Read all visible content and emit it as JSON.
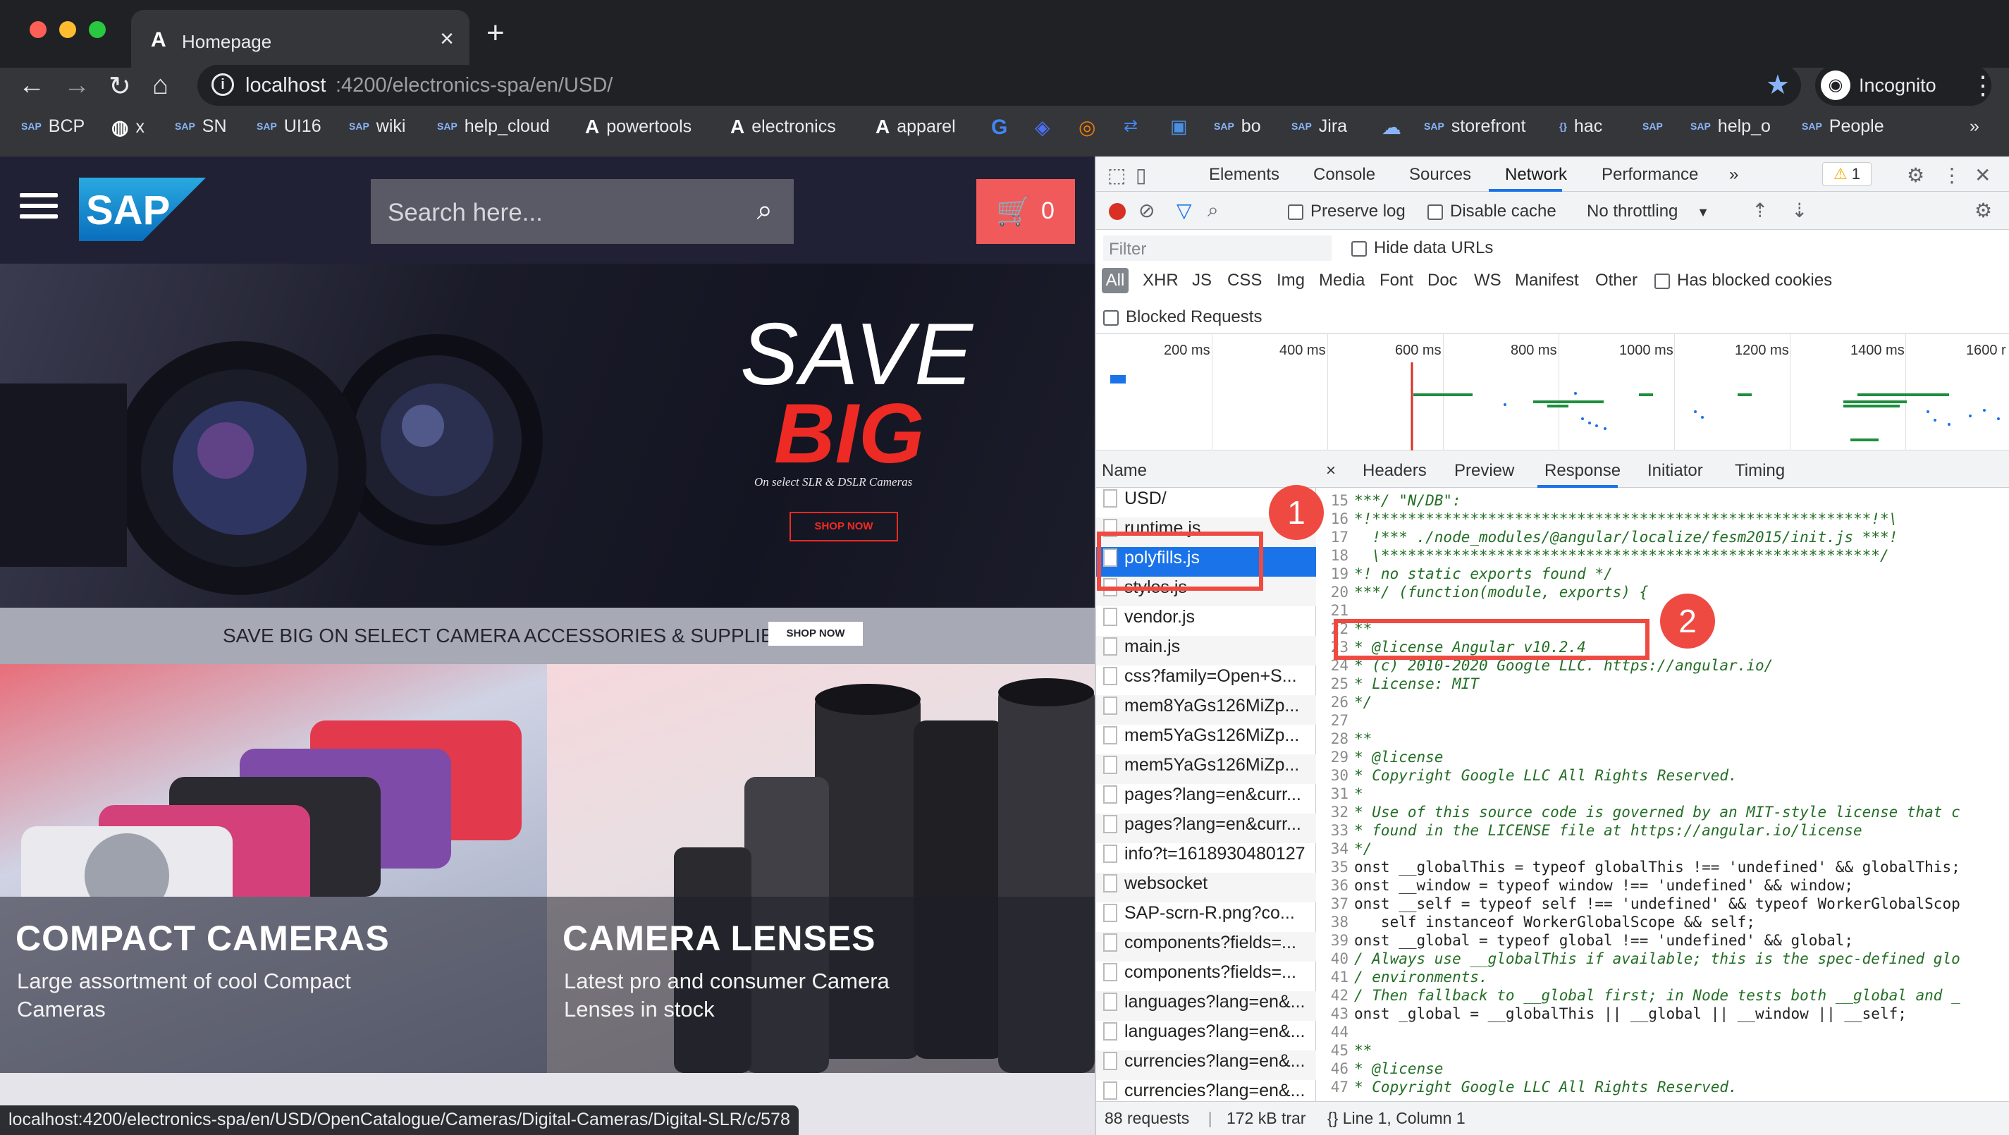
{
  "browser": {
    "tab_title": "Homepage",
    "tab_icon": "angular-icon",
    "address_host": "localhost",
    "address_path": ":4200/electronics-spa/en/USD/",
    "profile_label": "Incognito",
    "status_url": "localhost:4200/electronics-spa/en/USD/OpenCatalogue/Cameras/Digital-Cameras/Digital-SLR/c/578"
  },
  "bookmarks": [
    {
      "label": "BCP",
      "icon": "sap-icon"
    },
    {
      "label": "x",
      "icon": "globe-icon"
    },
    {
      "label": "SN",
      "icon": "sap-icon"
    },
    {
      "label": "UI16",
      "icon": "sap-icon"
    },
    {
      "label": "wiki",
      "icon": "sap-icon"
    },
    {
      "label": "help_cloud",
      "icon": "sap-icon"
    },
    {
      "label": "powertools",
      "icon": "angular-icon"
    },
    {
      "label": "electronics",
      "icon": "angular-icon"
    },
    {
      "label": "apparel",
      "icon": "angular-icon"
    },
    {
      "label": "bo",
      "icon": "sap-icon"
    },
    {
      "label": "Jira",
      "icon": "sap-icon"
    },
    {
      "label": "storefront",
      "icon": "sap-icon"
    },
    {
      "label": "hac",
      "icon": "sap-icon"
    },
    {
      "label": "help_o",
      "icon": "sap-icon"
    },
    {
      "label": "People",
      "icon": "sap-icon"
    },
    {
      "label": "»",
      "icon": "more-icon"
    }
  ],
  "site": {
    "search_placeholder": "Search here...",
    "cart_count": "0",
    "hero_line1": "SAVE",
    "hero_line2": "BIG",
    "hero_sub": "On select SLR & DSLR Cameras",
    "hero_button": "SHOP NOW",
    "promo_text": "SAVE BIG ON SELECT CAMERA ACCESSORIES & SUPPLIES",
    "promo_button": "SHOP NOW",
    "tiles": [
      {
        "title": "COMPACT CAMERAS",
        "desc": "Large assortment of cool Compact Cameras"
      },
      {
        "title": "CAMERA LENSES",
        "desc": "Latest pro and consumer Camera Lenses in stock"
      }
    ]
  },
  "devtools": {
    "tabs": [
      "Elements",
      "Console",
      "Sources",
      "Network",
      "Performance",
      "»"
    ],
    "active_tab": "Network",
    "warning_count": "1",
    "preserve_log": "Preserve log",
    "disable_cache": "Disable cache",
    "throttling": "No throttling",
    "filter_placeholder": "Filter",
    "hide_data_urls": "Hide data URLs",
    "types": [
      "All",
      "XHR",
      "JS",
      "CSS",
      "Img",
      "Media",
      "Font",
      "Doc",
      "WS",
      "Manifest",
      "Other"
    ],
    "has_blocked_cookies": "Has blocked cookies",
    "blocked_requests": "Blocked Requests",
    "timeline_ticks": [
      "200 ms",
      "400 ms",
      "600 ms",
      "800 ms",
      "1000 ms",
      "1200 ms",
      "1400 ms",
      "1600 r"
    ],
    "name_header": "Name",
    "requests": [
      "USD/",
      "runtime.js",
      "polyfills.js",
      "styles.js",
      "vendor.js",
      "main.js",
      "css?family=Open+S...",
      "mem8YaGs126MiZp...",
      "mem5YaGs126MiZp...",
      "mem5YaGs126MiZp...",
      "pages?lang=en&curr...",
      "pages?lang=en&curr...",
      "info?t=1618930480127",
      "websocket",
      "SAP-scrn-R.png?co...",
      "components?fields=...",
      "components?fields=...",
      "languages?lang=en&...",
      "languages?lang=en&...",
      "currencies?lang=en&...",
      "currencies?lang=en&..."
    ],
    "selected_request": "polyfills.js",
    "footer_requests": "88 requests",
    "footer_transfer": "172 kB trar",
    "detail_tabs": [
      "×",
      "Headers",
      "Preview",
      "Response",
      "Initiator",
      "Timing"
    ],
    "active_detail_tab": "Response",
    "code_lines": [
      {
        "n": "15",
        "t": "***/ \"N/DB\":",
        "kind": "comment"
      },
      {
        "n": "16",
        "t": "*!********************************************************!*\\",
        "kind": "comment"
      },
      {
        "n": "17",
        "t": "  !*** ./node_modules/@angular/localize/fesm2015/init.js ***!",
        "kind": "comment"
      },
      {
        "n": "18",
        "t": "  \\********************************************************/",
        "kind": "comment"
      },
      {
        "n": "19",
        "t": "*! no static exports found */",
        "kind": "comment"
      },
      {
        "n": "20",
        "t": "***/ (function(module, exports) {",
        "kind": "comment"
      },
      {
        "n": "21",
        "t": "",
        "kind": "code"
      },
      {
        "n": "22",
        "t": "**",
        "kind": "comment"
      },
      {
        "n": "23",
        "t": "* @license Angular v10.2.4",
        "kind": "comment"
      },
      {
        "n": "24",
        "t": "* (c) 2010-2020 Google LLC. https://angular.io/",
        "kind": "comment"
      },
      {
        "n": "25",
        "t": "* License: MIT",
        "kind": "comment"
      },
      {
        "n": "26",
        "t": "*/",
        "kind": "comment"
      },
      {
        "n": "27",
        "t": "",
        "kind": "code"
      },
      {
        "n": "28",
        "t": "**",
        "kind": "comment"
      },
      {
        "n": "29",
        "t": "* @license",
        "kind": "comment"
      },
      {
        "n": "30",
        "t": "* Copyright Google LLC All Rights Reserved.",
        "kind": "comment"
      },
      {
        "n": "31",
        "t": "*",
        "kind": "comment"
      },
      {
        "n": "32",
        "t": "* Use of this source code is governed by an MIT-style license that c",
        "kind": "comment"
      },
      {
        "n": "33",
        "t": "* found in the LICENSE file at https://angular.io/license",
        "kind": "comment"
      },
      {
        "n": "34",
        "t": "*/",
        "kind": "comment"
      },
      {
        "n": "35",
        "t": "onst __globalThis = typeof globalThis !== 'undefined' && globalThis;",
        "kind": "code"
      },
      {
        "n": "36",
        "t": "onst __window = typeof window !== 'undefined' && window;",
        "kind": "code"
      },
      {
        "n": "37",
        "t": "onst __self = typeof self !== 'undefined' && typeof WorkerGlobalScop",
        "kind": "code"
      },
      {
        "n": "38",
        "t": "   self instanceof WorkerGlobalScope && self;",
        "kind": "code"
      },
      {
        "n": "39",
        "t": "onst __global = typeof global !== 'undefined' && global;",
        "kind": "code"
      },
      {
        "n": "40",
        "t": "/ Always use __globalThis if available; this is the spec-defined glo",
        "kind": "comment"
      },
      {
        "n": "41",
        "t": "/ environments.",
        "kind": "comment"
      },
      {
        "n": "42",
        "t": "/ Then fallback to __global first; in Node tests both __global and _",
        "kind": "comment"
      },
      {
        "n": "43",
        "t": "onst _global = __globalThis || __global || __window || __self;",
        "kind": "code"
      },
      {
        "n": "44",
        "t": "",
        "kind": "code"
      },
      {
        "n": "45",
        "t": "**",
        "kind": "comment"
      },
      {
        "n": "46",
        "t": "* @license",
        "kind": "comment"
      },
      {
        "n": "47",
        "t": "* Copyright Google LLC All Rights Reserved.",
        "kind": "comment"
      }
    ],
    "detail_footer": "{}   Line 1, Column 1",
    "annotation_1": "1",
    "annotation_2": "2"
  },
  "colors": {
    "accent_red": "#ef4a42",
    "selection_blue": "#1a73e8",
    "sap_blue": "#1a8fd8"
  }
}
